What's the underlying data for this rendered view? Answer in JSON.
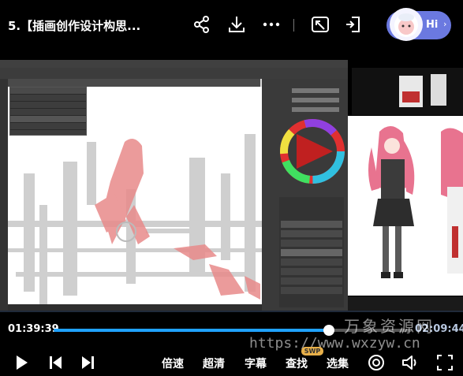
{
  "header": {
    "title": "5.【插画创作设计构思...",
    "assistant_label": "Hi",
    "icons": [
      "share-icon",
      "download-icon",
      "more-icon",
      "screen-cast-icon",
      "mini-window-icon"
    ]
  },
  "player": {
    "current_time": "01:39:39",
    "total_time": "02:09:44",
    "progress_fraction": 0.768,
    "controls": {
      "speed_label": "倍速",
      "quality_label": "超清",
      "subtitle_label": "字幕",
      "search_label": "查找",
      "episodes_label": "选集"
    }
  },
  "watermark": {
    "brand": "万象资源网",
    "url": "https://www.wxzyw.cn",
    "badge": "SWP"
  },
  "colors": {
    "accent": "#1fa2ff",
    "assistant_bg": "#6b79e0",
    "background": "#000000"
  }
}
